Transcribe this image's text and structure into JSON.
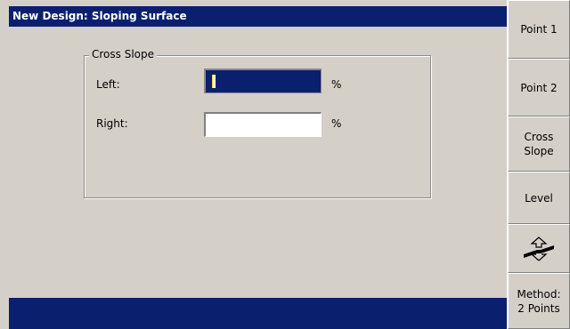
{
  "window": {
    "title": "New Design: Sloping Surface"
  },
  "group": {
    "label": "Cross Slope",
    "fields": [
      {
        "label": "Left:",
        "value": "",
        "unit": "%",
        "focused": true
      },
      {
        "label": "Right:",
        "value": "",
        "unit": "%",
        "focused": false
      }
    ]
  },
  "sidebar": {
    "buttons": [
      {
        "label": "Point 1"
      },
      {
        "label": "Point 2"
      },
      {
        "label": "Cross\nSlope"
      },
      {
        "label": "Level"
      },
      {
        "icon": "flip-arrows-icon"
      },
      {
        "label": "Method:\n2 Points"
      }
    ]
  },
  "colors": {
    "accent": "#0a206f",
    "panel": "#d4d0c8"
  }
}
